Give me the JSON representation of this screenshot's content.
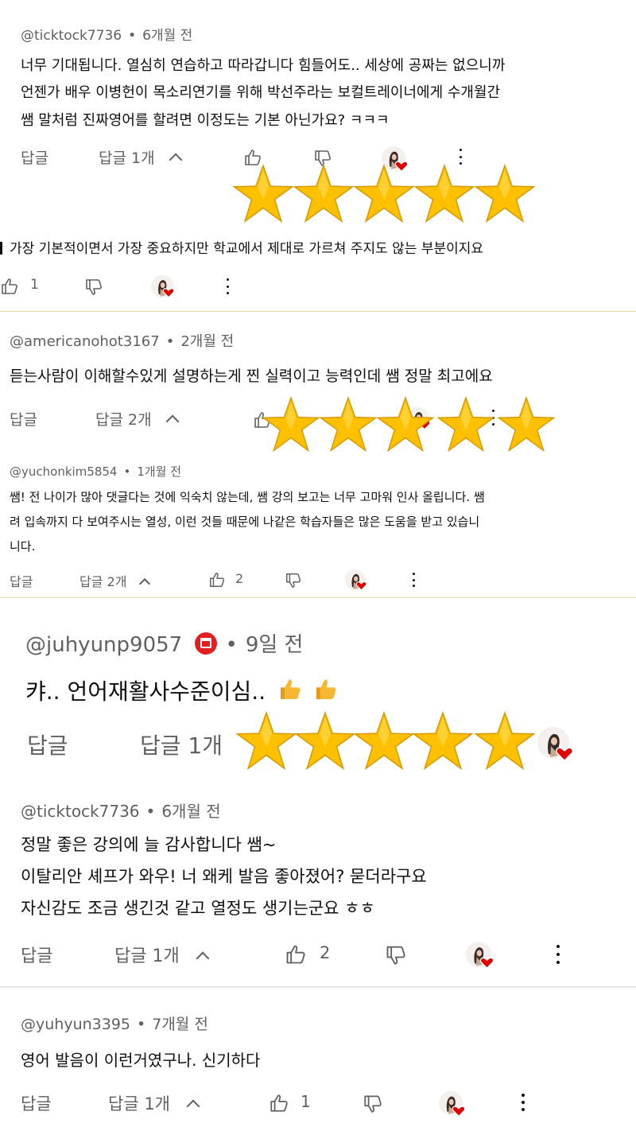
{
  "colors": {
    "star": "#FFC000",
    "star_stroke": "#E0A000",
    "heart": "#E00000",
    "red_badge": "#E02020",
    "divider": "#E8D9A0",
    "thumb_emoji": "#F3B23A"
  },
  "c1": {
    "handle": "@ticktock7736",
    "dot": "•",
    "time": "6개월 전",
    "lines": [
      "너무 기대됩니다. 열심히 연습하고 따라갑니다 힘들어도.. 세상에 공짜는 없으니까",
      "언젠가 배우 이병헌이 목소리연기를 위해 박선주라는 보컬트레이너에게 수개월간",
      "쌤 말처럼 진짜영어를 할려면 이정도는 기본 아닌가요? ㅋㅋㅋ"
    ],
    "reply_label": "답글",
    "replies_label": "답글 1개"
  },
  "c1r": {
    "text": "가장 기본적이면서 가장 중요하지만 학교에서 제대로 가르쳐 주지도 않는 부분이지요",
    "likes": "1"
  },
  "c2": {
    "handle": "@americanohot3167",
    "dot": "•",
    "time": "2개월 전",
    "text": "듣는사람이 이해할수있게 설명하는게 찐 실력이고 능력인데 쌤 정말 최고에요",
    "reply_label": "답글",
    "replies_label": "답글 2개"
  },
  "c3": {
    "handle": "@yuchonkim5854",
    "dot": "•",
    "time": "1개월 전",
    "lines": [
      "쌤! 전 나이가 많아 댓글다는 것에 익숙치 않는데, 쌤 강의 보고는 너무 고마워 인사 올립니다. 쌤",
      "려 입속까지 다 보여주시는 열성, 이런 것들 때문에 나같은 학습자들은 많은 도움을 받고 있습니",
      "니다."
    ],
    "reply_label": "답글",
    "replies_label": "답글 2개",
    "likes": "2"
  },
  "c4": {
    "handle": "@juhyunp9057",
    "dot": "•",
    "time": "9일 전",
    "text": "캬.. 언어재활사수준이심..",
    "reply_label": "답글",
    "replies_label": "답글 1개"
  },
  "c5": {
    "handle": "@ticktock7736",
    "dot": "•",
    "time": "6개월 전",
    "lines": [
      "정말 좋은 강의에 늘 감사합니다 쌤~",
      "이탈리안 셰프가 와우! 너 왜케 발음 좋아졌어? 묻더라구요",
      "자신감도 조금 생긴것 같고 열정도 생기는군요 ㅎㅎ"
    ],
    "reply_label": "답글",
    "replies_label": "답글 1개",
    "likes": "2"
  },
  "c6": {
    "handle": "@yuhyun3395",
    "dot": "•",
    "time": "7개월 전",
    "text": "영어 발음이 이런거였구나.  신기하다",
    "reply_label": "답글",
    "replies_label": "답글 1개",
    "likes": "1"
  },
  "icons": {
    "like": "thumb-up-outline",
    "dislike": "thumb-down-outline",
    "more": "vertical-ellipsis",
    "heart_avatar": "creator-heart",
    "star": "gold-star",
    "collapse": "chevron-up",
    "badge": "red-gift-badge",
    "thumbs_emoji": "thumbs-up-emoji"
  }
}
